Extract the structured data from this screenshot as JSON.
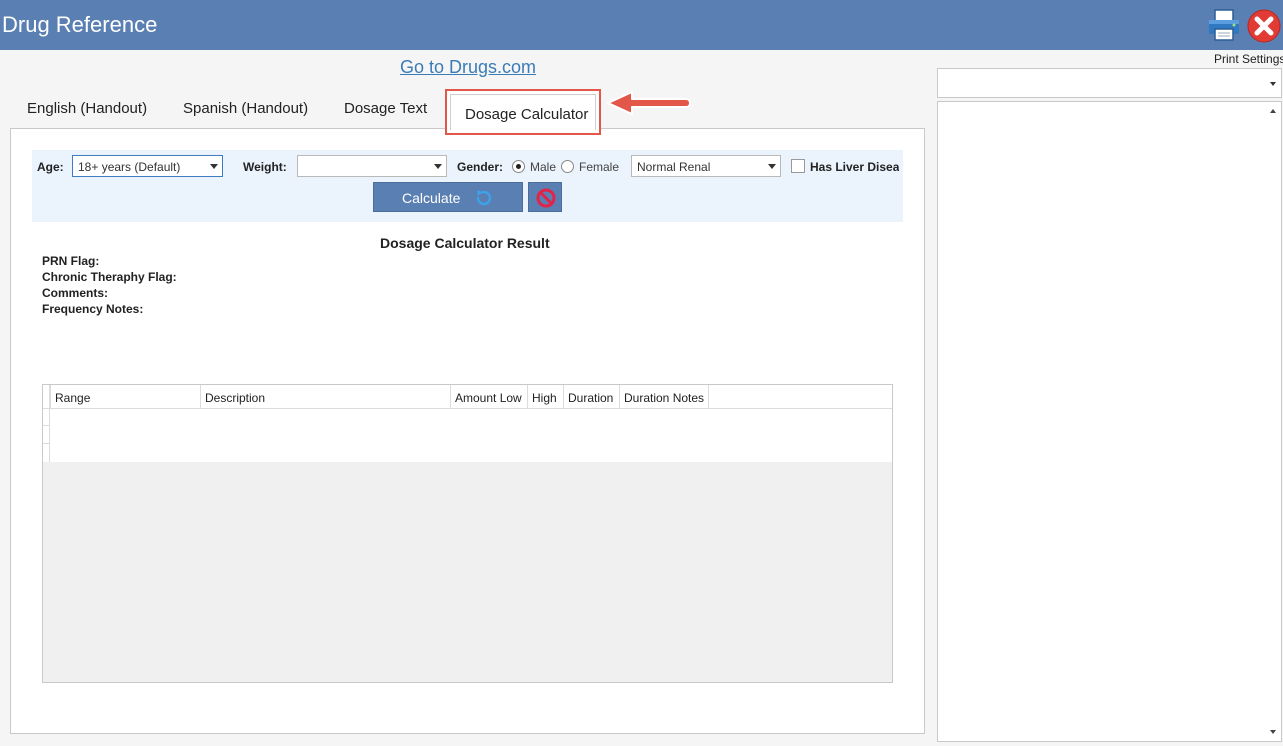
{
  "window": {
    "title": "Drug Reference"
  },
  "toolbar": {
    "print_settings_label": "Print Settings",
    "print_icon": "printer-icon",
    "close_icon": "close-icon"
  },
  "link": {
    "drugs_com": "Go to Drugs.com"
  },
  "tabs": [
    {
      "label": "English (Handout)",
      "active": false
    },
    {
      "label": "Spanish (Handout)",
      "active": false
    },
    {
      "label": "Dosage Text",
      "active": false
    },
    {
      "label": "Dosage Calculator",
      "active": true
    }
  ],
  "filters": {
    "age_label": "Age:",
    "age_value": "18+ years (Default)",
    "weight_label": "Weight:",
    "weight_value": "",
    "gender_label": "Gender:",
    "gender_options": [
      "Male",
      "Female"
    ],
    "gender_selected": "Male",
    "renal_value": "Normal Renal",
    "liver_label": "Has Liver Diseas",
    "liver_checked": false
  },
  "buttons": {
    "calculate_label": "Calculate"
  },
  "result": {
    "title": "Dosage Calculator Result",
    "fields": [
      "PRN Flag:",
      "Chronic Theraphy Flag:",
      "Comments:",
      "Frequency Notes:"
    ]
  },
  "grid": {
    "columns": [
      "Range",
      "Description",
      "Amount Low",
      "High",
      "Duration",
      "Duration Notes"
    ],
    "rows": []
  },
  "colors": {
    "titlebar": "#5a7fb3",
    "accent_red": "#e3564a",
    "link": "#3b7cb7",
    "filter_bg": "#ebf3fc"
  }
}
